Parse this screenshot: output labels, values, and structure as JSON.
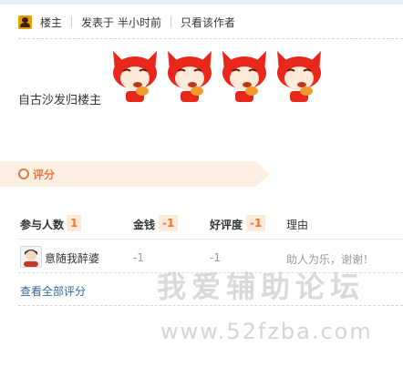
{
  "post": {
    "author_label": "楼主",
    "posted_prefix": "发表于",
    "posted_time": "半小时前",
    "only_author_link": "只看该作者",
    "reply_text": "自古沙发归楼主",
    "emoticon_count": 4
  },
  "rating": {
    "section_title": "评分",
    "headers": {
      "participants_label": "参与人数",
      "participants_count": "1",
      "money_label": "金钱",
      "money_total": "-1",
      "favor_label": "好评度",
      "favor_total": "-1",
      "reason_label": "理由"
    },
    "rows": [
      {
        "username": "意随我醉婆",
        "money": "-1",
        "favor": "-1",
        "reason": "助人为乐，谢谢！"
      }
    ],
    "view_all": "查看全部评分"
  },
  "watermark": {
    "title": "我爱辅助论坛",
    "url": "www.52fzba.com"
  },
  "colors": {
    "accent": "#e8773a",
    "link": "#336699",
    "emoticon_red": "#e8261a"
  }
}
